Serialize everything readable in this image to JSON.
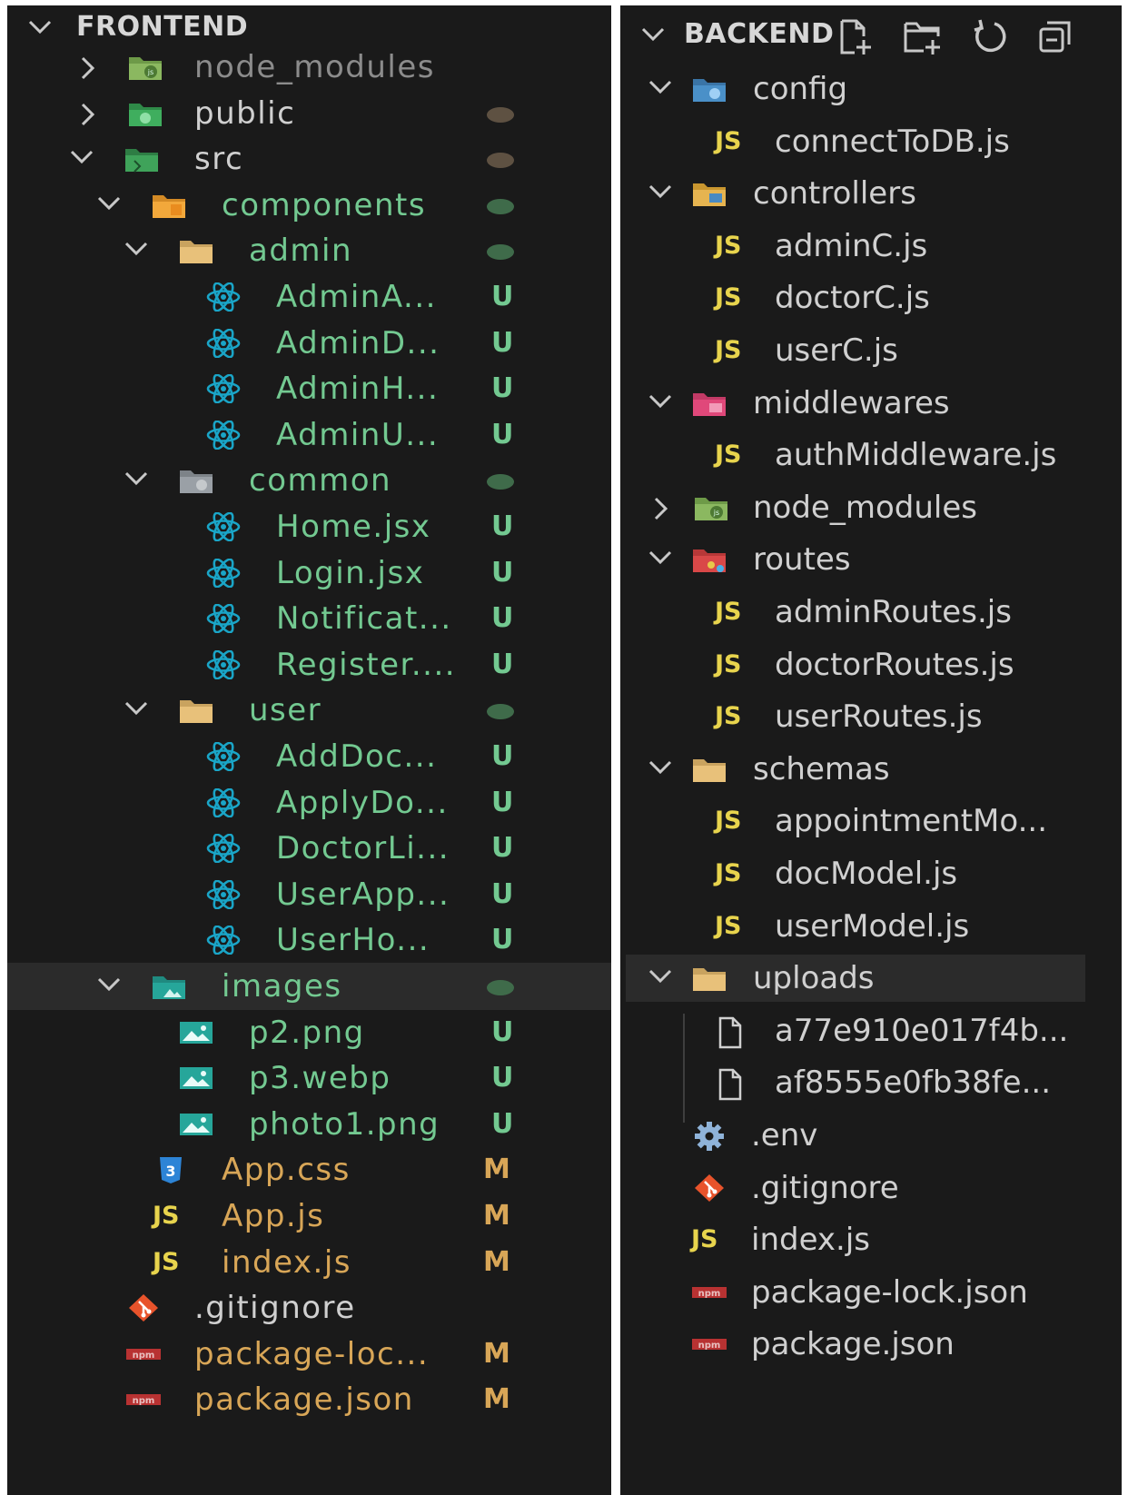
{
  "colors": {
    "panel_bg": "#1a1a1a",
    "git_untracked": "#73c991",
    "git_modified": "#d8a657",
    "js_icon": "#e8d44d",
    "react_icon": "#1aa5c7"
  },
  "frontend": {
    "title": "FRONTEND",
    "items": [
      {
        "label": "node_modules",
        "icon": "folder-node-icon",
        "chevron": "right",
        "style": "dim",
        "status": "",
        "dot": ""
      },
      {
        "label": "public",
        "icon": "folder-public-icon",
        "chevron": "right",
        "style": "",
        "status": "",
        "dot": "tan"
      },
      {
        "label": "src",
        "icon": "folder-src-icon",
        "chevron": "down",
        "style": "",
        "status": "",
        "dot": "tan"
      },
      {
        "label": "components",
        "icon": "folder-components-icon",
        "chevron": "down",
        "style": "green",
        "status": "",
        "dot": "green"
      },
      {
        "label": "admin",
        "icon": "folder-icon",
        "chevron": "down",
        "style": "green",
        "status": "",
        "dot": "green"
      },
      {
        "label": "AdminA...",
        "icon": "react-icon",
        "chevron": "",
        "style": "green",
        "status": "U",
        "dot": ""
      },
      {
        "label": "AdminD...",
        "icon": "react-icon",
        "chevron": "",
        "style": "green",
        "status": "U",
        "dot": ""
      },
      {
        "label": "AdminH...",
        "icon": "react-icon",
        "chevron": "",
        "style": "green",
        "status": "U",
        "dot": ""
      },
      {
        "label": "AdminU...",
        "icon": "react-icon",
        "chevron": "",
        "style": "green",
        "status": "U",
        "dot": ""
      },
      {
        "label": "common",
        "icon": "folder-common-icon",
        "chevron": "down",
        "style": "green",
        "status": "",
        "dot": "green"
      },
      {
        "label": "Home.jsx",
        "icon": "react-icon",
        "chevron": "",
        "style": "green",
        "status": "U",
        "dot": ""
      },
      {
        "label": "Login.jsx",
        "icon": "react-icon",
        "chevron": "",
        "style": "green",
        "status": "U",
        "dot": ""
      },
      {
        "label": "Notificat...",
        "icon": "react-icon",
        "chevron": "",
        "style": "green",
        "status": "U",
        "dot": ""
      },
      {
        "label": "Register....",
        "icon": "react-icon",
        "chevron": "",
        "style": "green",
        "status": "U",
        "dot": ""
      },
      {
        "label": "user",
        "icon": "folder-icon",
        "chevron": "down",
        "style": "green",
        "status": "",
        "dot": "green"
      },
      {
        "label": "AddDoc...",
        "icon": "react-icon",
        "chevron": "",
        "style": "green",
        "status": "U",
        "dot": ""
      },
      {
        "label": "ApplyDo...",
        "icon": "react-icon",
        "chevron": "",
        "style": "green",
        "status": "U",
        "dot": ""
      },
      {
        "label": "DoctorLi...",
        "icon": "react-icon",
        "chevron": "",
        "style": "green",
        "status": "U",
        "dot": ""
      },
      {
        "label": "UserApp...",
        "icon": "react-icon",
        "chevron": "",
        "style": "green",
        "status": "U",
        "dot": ""
      },
      {
        "label": "UserHo...",
        "icon": "react-icon",
        "chevron": "",
        "style": "green",
        "status": "U",
        "dot": ""
      },
      {
        "label": "images",
        "icon": "folder-images-icon",
        "chevron": "down",
        "style": "green",
        "status": "",
        "dot": "green",
        "selected": true
      },
      {
        "label": "p2.png",
        "icon": "image-file-icon",
        "chevron": "",
        "style": "green",
        "status": "U",
        "dot": ""
      },
      {
        "label": "p3.webp",
        "icon": "image-file-icon",
        "chevron": "",
        "style": "green",
        "status": "U",
        "dot": ""
      },
      {
        "label": "photo1.png",
        "icon": "image-file-icon",
        "chevron": "",
        "style": "green",
        "status": "U",
        "dot": ""
      },
      {
        "label": "App.css",
        "icon": "css-icon",
        "chevron": "",
        "style": "modified",
        "status": "M",
        "dot": ""
      },
      {
        "label": "App.js",
        "icon": "js-icon",
        "chevron": "",
        "style": "modified",
        "status": "M",
        "dot": ""
      },
      {
        "label": "index.js",
        "icon": "js-icon",
        "chevron": "",
        "style": "modified",
        "status": "M",
        "dot": ""
      },
      {
        "label": ".gitignore",
        "icon": "git-icon",
        "chevron": "",
        "style": "",
        "status": "",
        "dot": ""
      },
      {
        "label": "package-loc...",
        "icon": "npm-icon",
        "chevron": "",
        "style": "modified",
        "status": "M",
        "dot": ""
      },
      {
        "label": "package.json",
        "icon": "npm-icon",
        "chevron": "",
        "style": "modified",
        "status": "M",
        "dot": ""
      }
    ]
  },
  "backend": {
    "title": "BACKEND",
    "toolbar": [
      "new-file-icon",
      "new-folder-icon",
      "refresh-icon",
      "collapse-all-icon"
    ],
    "items": [
      {
        "label": "config",
        "icon": "folder-config-icon",
        "chevron": "down"
      },
      {
        "label": "connectToDB.js",
        "icon": "js-icon",
        "chevron": ""
      },
      {
        "label": "controllers",
        "icon": "folder-controllers-icon",
        "chevron": "down"
      },
      {
        "label": "adminC.js",
        "icon": "js-icon",
        "chevron": ""
      },
      {
        "label": "doctorC.js",
        "icon": "js-icon",
        "chevron": ""
      },
      {
        "label": "userC.js",
        "icon": "js-icon",
        "chevron": ""
      },
      {
        "label": "middlewares",
        "icon": "folder-middleware-icon",
        "chevron": "down"
      },
      {
        "label": "authMiddleware.js",
        "icon": "js-icon",
        "chevron": ""
      },
      {
        "label": "node_modules",
        "icon": "folder-node-icon",
        "chevron": "right"
      },
      {
        "label": "routes",
        "icon": "folder-routes-icon",
        "chevron": "down"
      },
      {
        "label": "adminRoutes.js",
        "icon": "js-icon",
        "chevron": ""
      },
      {
        "label": "doctorRoutes.js",
        "icon": "js-icon",
        "chevron": ""
      },
      {
        "label": "userRoutes.js",
        "icon": "js-icon",
        "chevron": ""
      },
      {
        "label": "schemas",
        "icon": "folder-icon",
        "chevron": "down"
      },
      {
        "label": "appointmentMo...",
        "icon": "js-icon",
        "chevron": ""
      },
      {
        "label": "docModel.js",
        "icon": "js-icon",
        "chevron": ""
      },
      {
        "label": "userModel.js",
        "icon": "js-icon",
        "chevron": ""
      },
      {
        "label": "uploads",
        "icon": "folder-icon",
        "chevron": "down",
        "selected": true
      },
      {
        "label": "a77e910e017f4b...",
        "icon": "blank-file-icon",
        "chevron": ""
      },
      {
        "label": "af8555e0fb38fe...",
        "icon": "blank-file-icon",
        "chevron": ""
      },
      {
        "label": ".env",
        "icon": "gear-icon",
        "chevron": ""
      },
      {
        "label": ".gitignore",
        "icon": "git-icon",
        "chevron": ""
      },
      {
        "label": "index.js",
        "icon": "js-icon",
        "chevron": ""
      },
      {
        "label": "package-lock.json",
        "icon": "npm-icon",
        "chevron": ""
      },
      {
        "label": "package.json",
        "icon": "npm-icon",
        "chevron": ""
      }
    ]
  }
}
